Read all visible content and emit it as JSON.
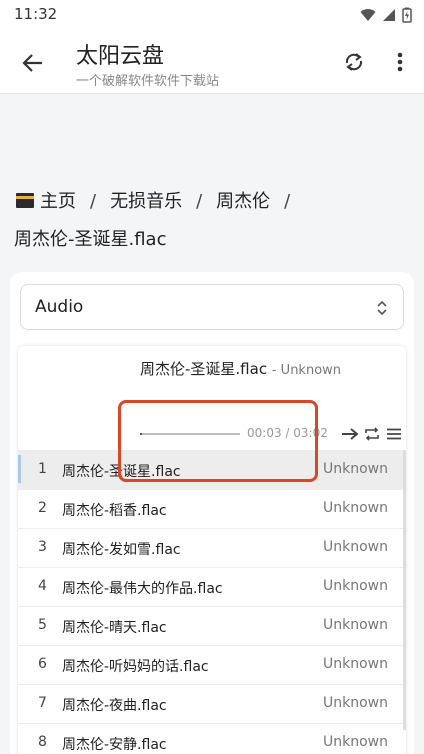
{
  "status": {
    "time": "11:32"
  },
  "app": {
    "title": "太阳云盘",
    "subtitle": "一个破解软件软件下载站"
  },
  "breadcrumb": {
    "home": "主页",
    "sep": "/",
    "folder1": "无损音乐",
    "folder2": "周杰伦",
    "file": "周杰伦-圣诞星.flac"
  },
  "select": {
    "value": "Audio"
  },
  "player": {
    "title": "周杰伦-圣诞星.flac",
    "artist": "- Unknown",
    "time": "00:03 / 03:02",
    "progress": 0.017
  },
  "playlist": [
    {
      "num": "1",
      "name": "周杰伦-圣诞星.flac",
      "artist": "Unknown",
      "active": true
    },
    {
      "num": "2",
      "name": "周杰伦-稻香.flac",
      "artist": "Unknown"
    },
    {
      "num": "3",
      "name": "周杰伦-发如雪.flac",
      "artist": "Unknown"
    },
    {
      "num": "4",
      "name": "周杰伦-最伟大的作品.flac",
      "artist": "Unknown"
    },
    {
      "num": "5",
      "name": "周杰伦-晴天.flac",
      "artist": "Unknown"
    },
    {
      "num": "6",
      "name": "周杰伦-听妈妈的话.flac",
      "artist": "Unknown"
    },
    {
      "num": "7",
      "name": "周杰伦-夜曲.flac",
      "artist": "Unknown"
    },
    {
      "num": "8",
      "name": "周杰伦-安静.flac",
      "artist": "Unknown"
    }
  ],
  "icons": {
    "back": "arrow-left-icon",
    "refresh": "refresh-icon",
    "more": "more-vert-icon",
    "home": "kaaba-emoji-icon",
    "next": "arrow-right-icon",
    "loop": "repeat-icon",
    "list": "menu-icon"
  },
  "colors": {
    "highlight": "#d9472b",
    "active_row": "#ededed"
  }
}
